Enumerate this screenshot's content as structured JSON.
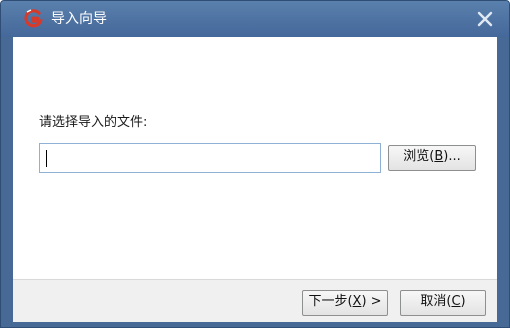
{
  "window": {
    "title": "导入向导",
    "logo_icon": "app-logo-icon",
    "close_icon": "close-icon"
  },
  "form": {
    "prompt": "请选择导入的文件:",
    "path_value": "",
    "browse_prefix": "浏览(",
    "browse_key": "B",
    "browse_suffix": ")..."
  },
  "footer": {
    "next_prefix": "下一步(",
    "next_key": "X",
    "next_suffix": ") >",
    "cancel_prefix": "取消(",
    "cancel_key": "C",
    "cancel_suffix": ")"
  },
  "colors": {
    "titlebar": "#466a95",
    "input_border": "#8fb1d6",
    "logo_red": "#d63a2a"
  }
}
